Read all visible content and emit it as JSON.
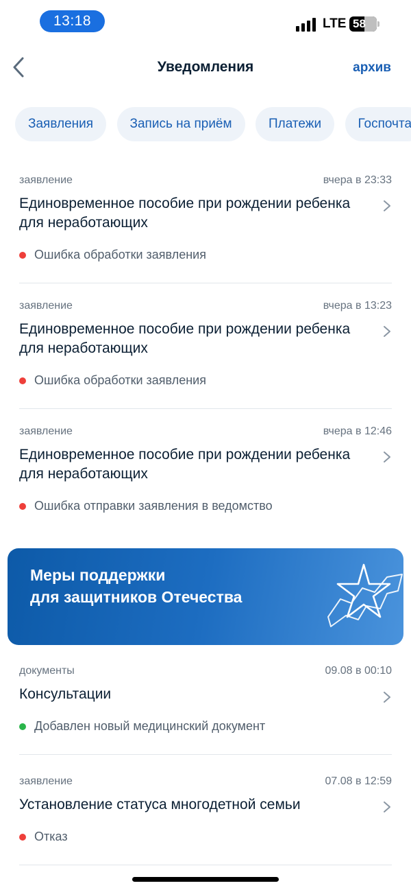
{
  "status_bar": {
    "time": "13:18",
    "network": "LTE",
    "battery": "58"
  },
  "header": {
    "title": "Уведомления",
    "archive_label": "архив"
  },
  "filters": [
    "Заявления",
    "Запись на приём",
    "Платежи",
    "Госпочта"
  ],
  "notifications": [
    {
      "type": "заявление",
      "date": "вчера в 23:33",
      "title": "Единовременное пособие при рождении ребенка для неработающих",
      "status": "Ошибка обработки заявления",
      "status_color": "#ee3f3a"
    },
    {
      "type": "заявление",
      "date": "вчера в 13:23",
      "title": "Единовременное пособие при рождении ребенка для неработающих",
      "status": "Ошибка обработки заявления",
      "status_color": "#ee3f3a"
    },
    {
      "type": "заявление",
      "date": "вчера в 12:46",
      "title": "Единовременное пособие при рождении ребенка для неработающих",
      "status": "Ошибка отправки заявления в ведомство",
      "status_color": "#ee3f3a"
    },
    {
      "type": "документы",
      "date": "09.08 в 00:10",
      "title": "Консультации",
      "status": "Добавлен новый медицинский документ",
      "status_color": "#2ab54a"
    },
    {
      "type": "заявление",
      "date": "07.08 в 12:59",
      "title": "Установление статуса многодетной семьи",
      "status": "Отказ",
      "status_color": "#ee3f3a"
    }
  ],
  "banner": {
    "line1": "Меры поддержки",
    "line2": "для защитников Отечества"
  },
  "colors": {
    "accent": "#1a5fb4",
    "error": "#ee3f3a",
    "success": "#2ab54a"
  },
  "icons": {
    "back": "chevron-left-icon",
    "item": "chevron-right-icon",
    "banner": "star-icon"
  }
}
